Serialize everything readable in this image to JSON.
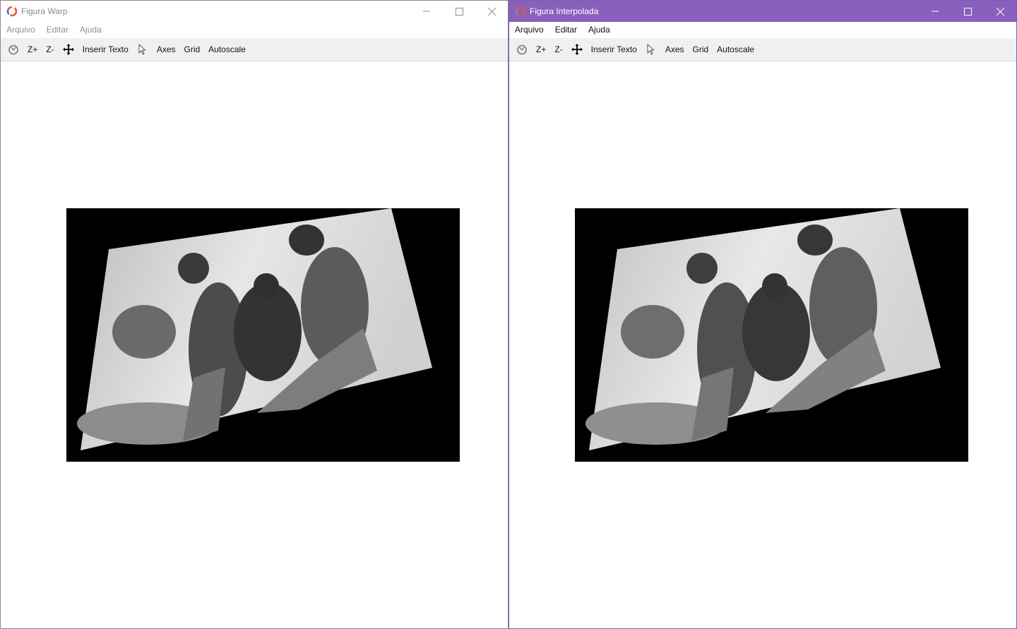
{
  "windows": [
    {
      "title": "Figura Warp",
      "menu": [
        "Arquivo",
        "Editar",
        "Ajuda"
      ],
      "toolbar": {
        "home_icon": "home-icon",
        "zoom_in": "Z+",
        "zoom_out": "Z-",
        "pan_icon": "move-icon",
        "insert_text": "Inserir Texto",
        "pointer_icon": "cursor-icon",
        "axes": "Axes",
        "grid": "Grid",
        "autoscale": "Autoscale"
      },
      "image": {
        "kind": "grayscale-warped-photo",
        "subject": "parrots"
      }
    },
    {
      "title": "Figura Interpolada",
      "menu": [
        "Arquivo",
        "Editar",
        "Ajuda"
      ],
      "toolbar": {
        "home_icon": "home-icon",
        "zoom_in": "Z+",
        "zoom_out": "Z-",
        "pan_icon": "move-icon",
        "insert_text": "Inserir Texto",
        "pointer_icon": "cursor-icon",
        "axes": "Axes",
        "grid": "Grid",
        "autoscale": "Autoscale"
      },
      "image": {
        "kind": "grayscale-interpolated-photo",
        "subject": "parrots"
      }
    }
  ],
  "colors": {
    "active_titlebar": "#8961bd",
    "toolbar_bg": "#f0f0f0",
    "plot_bg": "#000000"
  }
}
